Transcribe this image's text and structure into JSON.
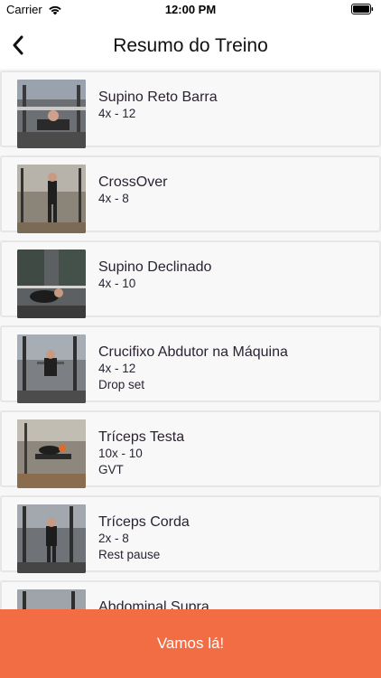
{
  "status": {
    "carrier": "Carrier",
    "time": "12:00 PM"
  },
  "nav": {
    "title": "Resumo do Treino"
  },
  "exercises": [
    {
      "name": "Supino Reto Barra",
      "sets": "4x - 12",
      "note": ""
    },
    {
      "name": "CrossOver",
      "sets": "4x - 8",
      "note": ""
    },
    {
      "name": "Supino Declinado",
      "sets": "4x - 10",
      "note": ""
    },
    {
      "name": "Crucifixo Abdutor na Máquina",
      "sets": "4x - 12",
      "note": "Drop set"
    },
    {
      "name": "Tríceps Testa",
      "sets": "10x - 10",
      "note": "GVT"
    },
    {
      "name": "Tríceps Corda",
      "sets": "2x - 8",
      "note": "Rest pause"
    },
    {
      "name": "Abdominal Supra",
      "sets": "",
      "note": ""
    }
  ],
  "cta": {
    "label": "Vamos lá!"
  },
  "colors": {
    "accent": "#f36d44"
  }
}
